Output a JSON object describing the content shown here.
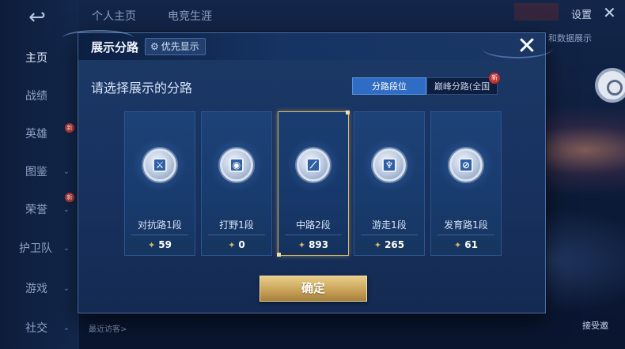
{
  "background": {
    "back_icon": "↩",
    "sidebar": [
      {
        "label": "主页",
        "active": true
      },
      {
        "label": "战绩"
      },
      {
        "label": "英雄",
        "badge": "新"
      },
      {
        "label": "图鉴",
        "chevron": "⌄"
      },
      {
        "label": "荣誉",
        "chevron": "⌄",
        "badge": "新"
      },
      {
        "label": "护卫队",
        "chevron": "⌄"
      },
      {
        "label": "游戏",
        "chevron": "⌄"
      },
      {
        "label": "社交",
        "chevron": "⌄"
      }
    ],
    "top_tabs": [
      "个人主页",
      "电竞生涯"
    ],
    "settings_label": "设置",
    "close_glyph": "✕",
    "right_link": "和数据展示",
    "recent_visitors": "最近访客>",
    "bottom_right_label": "接受邀"
  },
  "modal": {
    "title": "展示分路",
    "pref_button": {
      "icon": "gear-icon",
      "glyph": "⚙",
      "label": "优先显示"
    },
    "close_glyph": "✕",
    "prompt": "请选择展示的分路",
    "segments": {
      "rank_label": "分路段位",
      "peak_label": "巅峰分路(全国",
      "peak_badge": "新"
    },
    "lanes": [
      {
        "name": "对抗路1段",
        "score": "59",
        "glyph": "⚔",
        "selected": false
      },
      {
        "name": "打野1段",
        "score": "0",
        "glyph": "◉",
        "selected": false
      },
      {
        "name": "中路2段",
        "score": "893",
        "glyph": "⟋",
        "selected": true
      },
      {
        "name": "游走1段",
        "score": "265",
        "glyph": "♆",
        "selected": false
      },
      {
        "name": "发育路1段",
        "score": "61",
        "glyph": "⊘",
        "selected": false
      }
    ],
    "score_icon_glyph": "✦",
    "confirm_label": "确定"
  },
  "colors": {
    "accent_blue": "#2f6cc3",
    "gold": "#d9b76a",
    "panel": "#1c3966"
  }
}
